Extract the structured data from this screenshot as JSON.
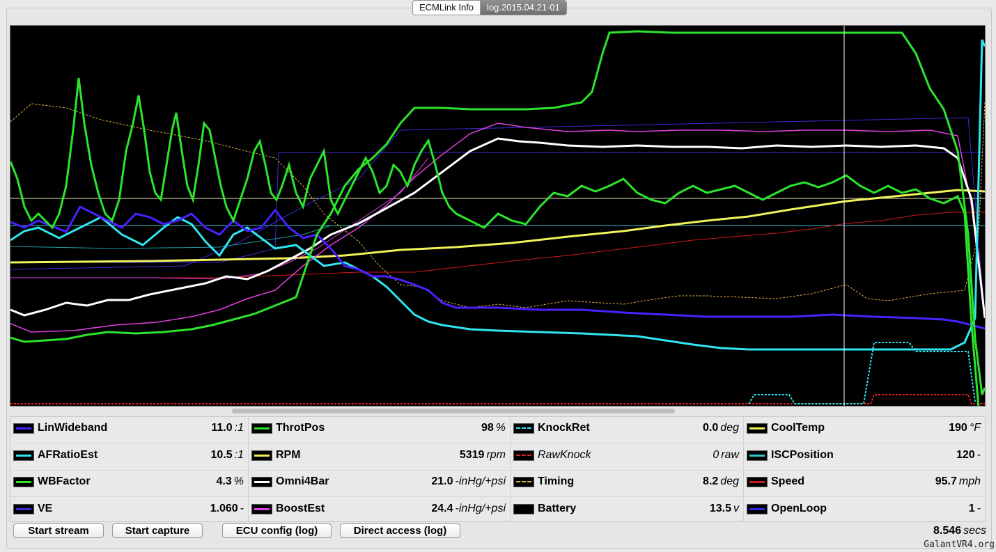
{
  "tabs": [
    {
      "label": "ECMLink Info",
      "selected": false
    },
    {
      "label": "log.2015.04.21-01",
      "selected": true
    }
  ],
  "legend": {
    "columns": [
      [
        {
          "name": "LinWideband",
          "value": "11.0",
          "unit": ":1",
          "color": "#4b1fff",
          "style": "solid"
        },
        {
          "name": "AFRatioEst",
          "value": "10.5",
          "unit": ":1",
          "color": "#30e6f0",
          "style": "solid"
        },
        {
          "name": "WBFactor",
          "value": "4.3",
          "unit": "%",
          "color": "#2be52b",
          "style": "solid"
        },
        {
          "name": "VE",
          "value": "1.060",
          "unit": "-",
          "color": "#3a2bd6",
          "style": "solid"
        }
      ],
      [
        {
          "name": "ThrotPos",
          "value": "98",
          "unit": "%",
          "color": "#2be52b",
          "style": "solid"
        },
        {
          "name": "RPM",
          "value": "5319",
          "unit": "rpm",
          "color": "#f2f25a",
          "style": "solid"
        },
        {
          "name": "Omni4Bar",
          "value": "21.0",
          "unit": "-inHg/+psi",
          "color": "#ffffff",
          "style": "solid"
        },
        {
          "name": "BoostEst",
          "value": "24.4",
          "unit": "-inHg/+psi",
          "color": "#e040e0",
          "style": "solid"
        }
      ],
      [
        {
          "name": "KnockRet",
          "value": "0.0",
          "unit": "deg",
          "color": "#30e6f0",
          "style": "dashed"
        },
        {
          "name": "RawKnock",
          "value": "0",
          "unit": "raw",
          "color": "#e02020",
          "style": "dashed",
          "italic": true
        },
        {
          "name": "Timing",
          "value": "8.2",
          "unit": "deg",
          "color": "#e0b040",
          "style": "dashed"
        },
        {
          "name": "Battery",
          "value": "13.5",
          "unit": "v",
          "color": "#000000",
          "style": "none"
        }
      ],
      [
        {
          "name": "CoolTemp",
          "value": "190",
          "unit": "°F",
          "color": "#f2f25a",
          "style": "solid"
        },
        {
          "name": "ISCPosition",
          "value": "120",
          "unit": "-",
          "color": "#30c8d0",
          "style": "solid"
        },
        {
          "name": "Speed",
          "value": "95.7",
          "unit": "mph",
          "color": "#d01818",
          "style": "solid"
        },
        {
          "name": "OpenLoop",
          "value": "1",
          "unit": "-",
          "color": "#2a2ae0",
          "style": "solid"
        }
      ]
    ]
  },
  "buttons": {
    "start_stream": "Start stream",
    "start_capture": "Start capture",
    "ecu_config": "ECU config (log)",
    "direct_access": "Direct access (log)"
  },
  "elapsed": {
    "value": "8.546",
    "unit": "secs"
  },
  "watermark": "GalantVR4.org"
}
